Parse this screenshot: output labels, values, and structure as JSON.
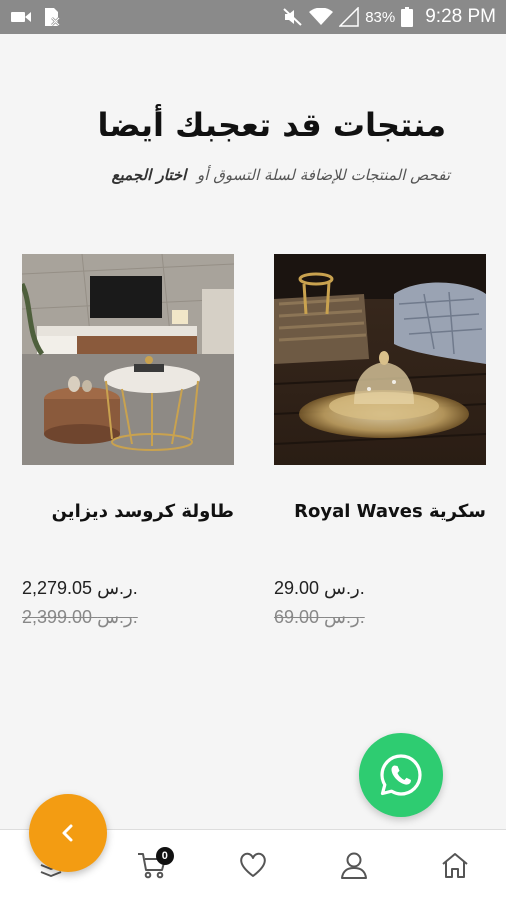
{
  "status_bar": {
    "battery_text": "83%",
    "time": "9:28 PM",
    "icons": [
      "video-camera-icon",
      "sim-blocked-icon",
      "mute-icon",
      "wifi-icon",
      "signal-icon",
      "battery-icon"
    ]
  },
  "section": {
    "title": "منتجات قد تعجبك أيضا",
    "subtitle": "تفحص المنتجات للإضافة لسلة التسوق أو",
    "select_all_label": "اختار الجميع"
  },
  "products": [
    {
      "title": "سكرية Royal Waves",
      "price": "29.00 ر.س.",
      "old_price": "69.00 ر.س.",
      "image": "glass-sugar-bowl"
    },
    {
      "title": "طاولة كروسد ديزاين",
      "price": "2,279.05 ر.س.",
      "old_price": "2,399.00 ر.س.",
      "image": "coffee-table"
    }
  ],
  "bottom_nav": {
    "cart_count": "0",
    "items": [
      "categories-icon",
      "cart-icon",
      "heart-icon",
      "user-icon",
      "home-icon"
    ]
  },
  "colors": {
    "accent_orange": "#f39c12",
    "whatsapp_green": "#2ecc71",
    "status_bar": "#8a8a8a"
  }
}
